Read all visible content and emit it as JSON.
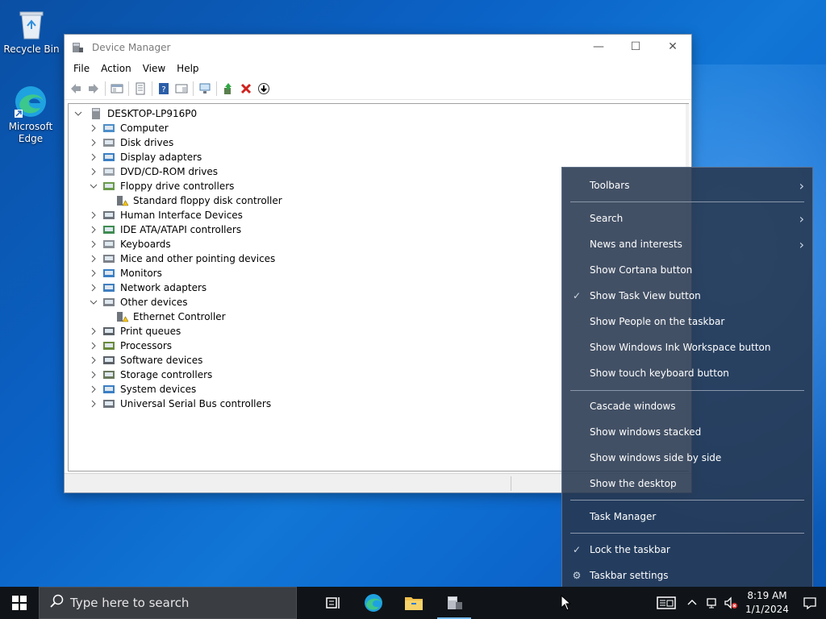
{
  "desktop": {
    "icons": [
      {
        "label": "Recycle Bin"
      },
      {
        "label": "Microsoft Edge"
      }
    ]
  },
  "window": {
    "title": "Device Manager",
    "controls": {
      "minimize": "—",
      "maximize": "☐",
      "close": "✕"
    },
    "menu": [
      "File",
      "Action",
      "View",
      "Help"
    ],
    "tree": {
      "root": "DESKTOP-LP916P0",
      "items": [
        {
          "label": "Computer",
          "expanded": false
        },
        {
          "label": "Disk drives",
          "expanded": false
        },
        {
          "label": "Display adapters",
          "expanded": false
        },
        {
          "label": "DVD/CD-ROM drives",
          "expanded": false
        },
        {
          "label": "Floppy drive controllers",
          "expanded": true
        },
        {
          "label": "Standard floppy disk controller",
          "child": true
        },
        {
          "label": "Human Interface Devices",
          "expanded": false
        },
        {
          "label": "IDE ATA/ATAPI controllers",
          "expanded": false
        },
        {
          "label": "Keyboards",
          "expanded": false
        },
        {
          "label": "Mice and other pointing devices",
          "expanded": false
        },
        {
          "label": "Monitors",
          "expanded": false
        },
        {
          "label": "Network adapters",
          "expanded": false
        },
        {
          "label": "Other devices",
          "expanded": true
        },
        {
          "label": "Ethernet Controller",
          "child": true
        },
        {
          "label": "Print queues",
          "expanded": false
        },
        {
          "label": "Processors",
          "expanded": false
        },
        {
          "label": "Software devices",
          "expanded": false
        },
        {
          "label": "Storage controllers",
          "expanded": false
        },
        {
          "label": "System devices",
          "expanded": false
        },
        {
          "label": "Universal Serial Bus controllers",
          "expanded": false
        }
      ]
    }
  },
  "context_menu": {
    "items": [
      {
        "label": "Toolbars",
        "submenu": true
      },
      {
        "label": "Search",
        "submenu": true
      },
      {
        "label": "News and interests",
        "submenu": true
      },
      {
        "label": "Show Cortana button"
      },
      {
        "label": "Show Task View button",
        "checked": true
      },
      {
        "label": "Show People on the taskbar"
      },
      {
        "label": "Show Windows Ink Workspace button"
      },
      {
        "label": "Show touch keyboard button"
      },
      {
        "label": "Cascade windows"
      },
      {
        "label": "Show windows stacked"
      },
      {
        "label": "Show windows side by side"
      },
      {
        "label": "Show the desktop"
      },
      {
        "label": "Task Manager"
      },
      {
        "label": "Lock the taskbar",
        "checked": true
      },
      {
        "label": "Taskbar settings",
        "icon": "gear-icon"
      }
    ],
    "check_glyph": "✓",
    "arrow_glyph": "›",
    "gear_glyph": "⚙"
  },
  "taskbar": {
    "search_placeholder": "Type here to search",
    "clock_time": "8:19 AM",
    "clock_date": "1/1/2024"
  }
}
